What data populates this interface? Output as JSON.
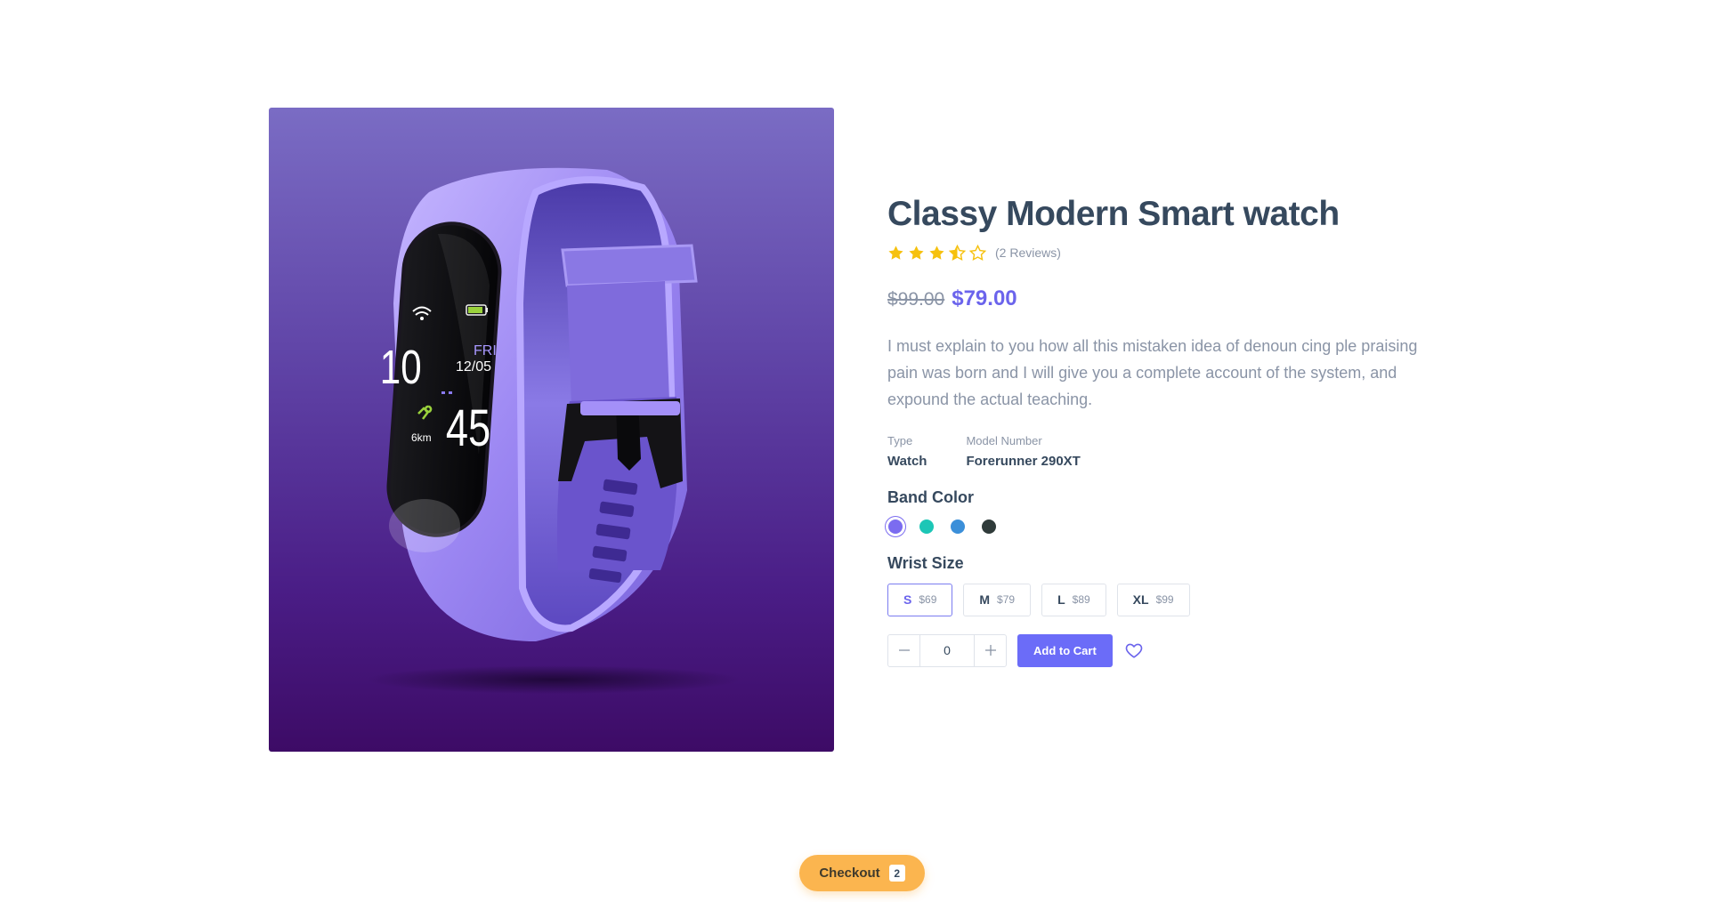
{
  "product": {
    "title": "Classy Modern Smart watch",
    "rating": 3.5,
    "rating_max": 5,
    "reviews_text": "(2 Reviews)",
    "price_old": "$99.00",
    "price_new": "$79.00",
    "description": "I must explain to you how all this mistaken idea of denoun cing ple praising pain was born and I will give you a complete account of the system, and expound the actual teaching.",
    "specs": [
      {
        "label": "Type",
        "value": "Watch"
      },
      {
        "label": "Model Number",
        "value": "Forerunner 290XT"
      }
    ],
    "image": {
      "watch_time_hour": "10",
      "watch_day": "FRI",
      "watch_date": "12/05",
      "watch_minute": "45",
      "watch_distance": "6km"
    }
  },
  "band_color": {
    "title": "Band Color",
    "options": [
      {
        "name": "violet",
        "color": "#7b6cf0",
        "selected": true
      },
      {
        "name": "teal",
        "color": "#1cc6b6",
        "selected": false
      },
      {
        "name": "blue",
        "color": "#3b8fd9",
        "selected": false
      },
      {
        "name": "charcoal",
        "color": "#2f3b3a",
        "selected": false
      }
    ]
  },
  "wrist_size": {
    "title": "Wrist Size",
    "options": [
      {
        "label": "S",
        "price": "$69",
        "selected": true
      },
      {
        "label": "M",
        "price": "$79",
        "selected": false
      },
      {
        "label": "L",
        "price": "$89",
        "selected": false
      },
      {
        "label": "XL",
        "price": "$99",
        "selected": false
      }
    ]
  },
  "cart": {
    "quantity": "0",
    "minus_symbol": "—",
    "plus_symbol": "+",
    "add_label": "Add to Cart"
  },
  "checkout": {
    "label": "Checkout",
    "count": "2"
  },
  "colors": {
    "accent": "#6b6cf8",
    "star": "#f6c10e",
    "checkout": "#fbb54f"
  },
  "icons": {
    "wishlist": "heart-icon",
    "star": "star-icon",
    "half_star": "star-half-icon",
    "empty_star": "star-outline-icon"
  }
}
